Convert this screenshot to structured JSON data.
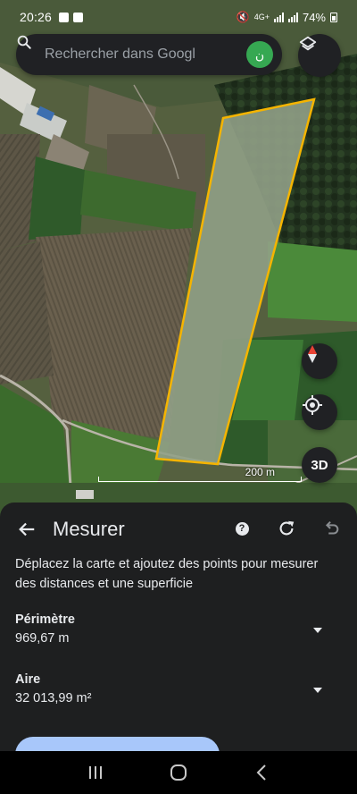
{
  "status_bar": {
    "time": "20:26",
    "network": "4G+",
    "battery": "74%"
  },
  "search": {
    "placeholder": "Rechercher dans Googl",
    "avatar_initial": "ن"
  },
  "map": {
    "scale_label": "200 m",
    "three_d_label": "3D",
    "polygon_color": "#f5b400"
  },
  "measure_panel": {
    "title": "Mesurer",
    "instructions": "Déplacez la carte et ajoutez des points pour mesurer des distances et une superficie",
    "perimeter": {
      "label": "Périmètre",
      "value": "969,67 m"
    },
    "area": {
      "label": "Aire",
      "value": "32 013,99 m²"
    },
    "icons": [
      "back-arrow-icon",
      "help-icon",
      "refresh-icon",
      "undo-icon"
    ]
  },
  "colors": {
    "sheet_bg": "#1e1f20",
    "accent": "#a8c7fa",
    "avatar": "#36a852"
  }
}
